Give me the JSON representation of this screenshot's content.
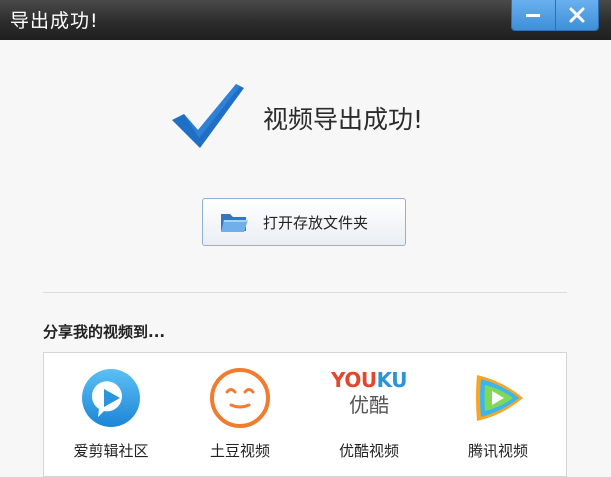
{
  "window": {
    "title": "导出成功!",
    "minimize_icon": "minimize-icon",
    "close_icon": "close-icon",
    "accent": "#3f8fd8"
  },
  "success": {
    "message": "视频导出成功!",
    "icon": "checkmark-icon",
    "icon_color": "#1f6fc7"
  },
  "open_folder": {
    "label": "打开存放文件夹",
    "icon": "folder-icon"
  },
  "share": {
    "title": "分享我的视频到...",
    "items": [
      {
        "label": "爱剪辑社区",
        "icon": "aijianji-community-icon"
      },
      {
        "label": "土豆视频",
        "icon": "tudou-icon"
      },
      {
        "label": "优酷视频",
        "icon": "youku-icon",
        "logo_en_1": "YOU",
        "logo_en_2": "KU",
        "logo_cn": "优酷"
      },
      {
        "label": "腾讯视频",
        "icon": "tencent-video-icon"
      }
    ]
  }
}
